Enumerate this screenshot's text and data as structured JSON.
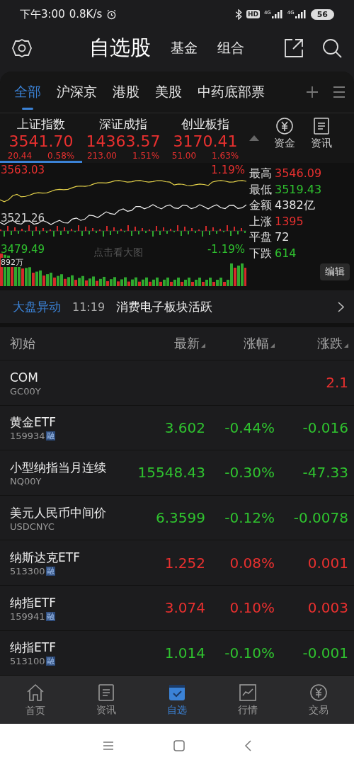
{
  "status_bar": {
    "time": "下午3:00",
    "speed": "0.8K/s",
    "hd": "HD",
    "networks": [
      "4G",
      "4G"
    ],
    "battery": "56"
  },
  "header": {
    "title": "自选股",
    "links": [
      {
        "label": "基金"
      },
      {
        "label": "组合"
      }
    ]
  },
  "tabs": [
    {
      "label": "全部",
      "selected": true
    },
    {
      "label": "沪深京",
      "selected": false
    },
    {
      "label": "港股",
      "selected": false
    },
    {
      "label": "美股",
      "selected": false
    },
    {
      "label": "中药底部票",
      "selected": false
    }
  ],
  "indices": [
    {
      "name": "上证指数",
      "value": "3541.70",
      "change": "20.44",
      "percent": "0.58%",
      "kind": "up",
      "selected": true
    },
    {
      "name": "深证成指",
      "value": "14363.57",
      "change": "213.00",
      "percent": "1.51%",
      "kind": "up",
      "selected": false
    },
    {
      "name": "创业板指",
      "value": "3170.41",
      "change": "51.00",
      "percent": "1.63%",
      "kind": "up",
      "selected": false
    }
  ],
  "quick_links": [
    {
      "label": "资金"
    },
    {
      "label": "资讯"
    }
  ],
  "intraday": {
    "high_price": "3563.03",
    "mid_price": "3521.26",
    "low_price": "3479.49",
    "high_pct": "1.19%",
    "low_pct": "-1.19%",
    "volume": "892万",
    "hint": "点击看大图"
  },
  "stats": [
    {
      "label": "最高",
      "value": "3546.09",
      "kind": "up"
    },
    {
      "label": "最低",
      "value": "3519.43",
      "kind": "down"
    },
    {
      "label": "金额",
      "value": "4382亿",
      "kind": "flat"
    },
    {
      "label": "上涨",
      "value": "1395",
      "kind": "up"
    },
    {
      "label": "平盘",
      "value": "72",
      "kind": "flat"
    },
    {
      "label": "下跌",
      "value": "614",
      "kind": "down"
    }
  ],
  "edit_button": "编辑",
  "market_alert": {
    "tag": "大盘异动",
    "time": "11:19",
    "text": "消费电子板块活跃"
  },
  "table": {
    "columns": [
      "初始",
      "最新",
      "涨幅",
      "涨跌"
    ],
    "rows": [
      {
        "name": "COM",
        "code": "GC00Y",
        "change": "2.1",
        "kind": "up"
      },
      {
        "name": "黄金ETF",
        "code": "159934",
        "badge": "融",
        "price": "3.602",
        "percent": "-0.44%",
        "change": "-0.016",
        "kind": "down"
      },
      {
        "name": "小型纳指当月连续",
        "code": "NQ00Y",
        "price": "15548.43",
        "percent": "-0.30%",
        "change": "-47.33",
        "kind": "down"
      },
      {
        "name": "美元人民币中间价",
        "code": "USDCNYC",
        "price": "6.3599",
        "percent": "-0.12%",
        "change": "-0.0078",
        "kind": "down"
      },
      {
        "name": "纳斯达克ETF",
        "code": "513300",
        "badge": "融",
        "price": "1.252",
        "percent": "0.08%",
        "change": "0.001",
        "kind": "up"
      },
      {
        "name": "纳指ETF",
        "code": "159941",
        "badge": "融",
        "price": "3.074",
        "percent": "0.10%",
        "change": "0.003",
        "kind": "up"
      },
      {
        "name": "纳指ETF",
        "code": "513100",
        "badge": "融",
        "price": "1.014",
        "percent": "-0.10%",
        "change": "-0.001",
        "kind": "down"
      }
    ]
  },
  "bottom_nav": [
    {
      "label": "首页",
      "selected": false
    },
    {
      "label": "资讯",
      "selected": false
    },
    {
      "label": "自选",
      "selected": true
    },
    {
      "label": "行情",
      "selected": false
    },
    {
      "label": "交易",
      "selected": false
    }
  ]
}
